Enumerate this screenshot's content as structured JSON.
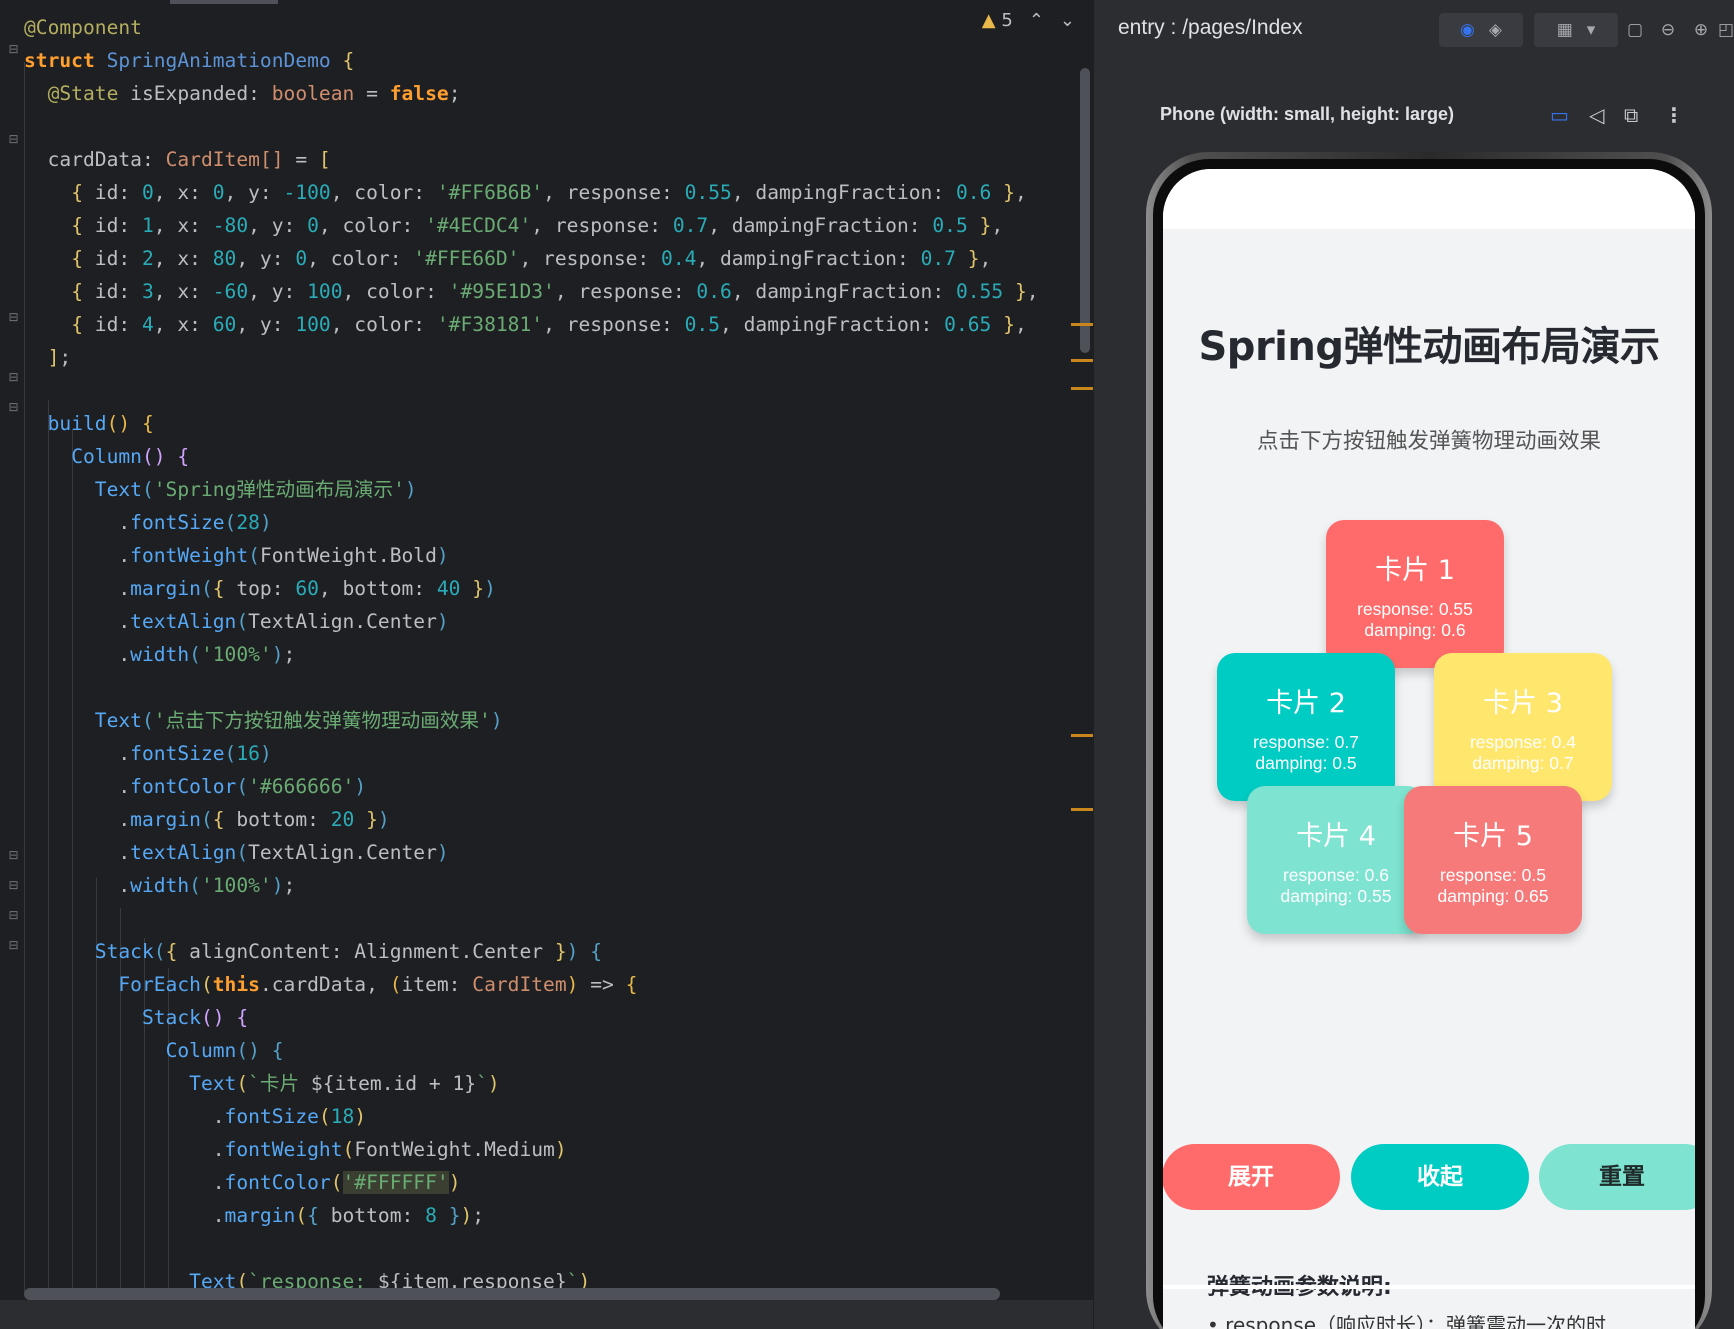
{
  "editor": {
    "warnings_count": "5",
    "lines": [
      {
        "indent": 0,
        "parts": [
          [
            "an",
            "@Component"
          ]
        ]
      },
      {
        "indent": 0,
        "parts": [
          [
            "kb",
            "struct"
          ],
          [
            "cg",
            " "
          ],
          [
            "ty",
            "SpringAnimationDemo"
          ],
          [
            "cg",
            " "
          ],
          [
            "co",
            "{"
          ]
        ]
      },
      {
        "indent": 1,
        "parts": [
          [
            "an",
            "@State"
          ],
          [
            "cg",
            " isExpanded: "
          ],
          [
            "k",
            "boolean"
          ],
          [
            "cg",
            " = "
          ],
          [
            "kb",
            "false"
          ],
          [
            "cg",
            ";"
          ]
        ]
      },
      {
        "indent": 0,
        "parts": []
      },
      {
        "indent": 1,
        "parts": [
          [
            "cg",
            "cardData: "
          ],
          [
            "k",
            "CardItem"
          ],
          [
            "k",
            "[]"
          ],
          [
            "cg",
            " = "
          ],
          [
            "co",
            "["
          ]
        ]
      },
      {
        "indent": 2,
        "parts": [
          [
            "co",
            "{"
          ],
          [
            "cg",
            " id: "
          ],
          [
            "nm",
            "0"
          ],
          [
            "cg",
            ", x: "
          ],
          [
            "nm",
            "0"
          ],
          [
            "cg",
            ", y: "
          ],
          [
            "nm",
            "-100"
          ],
          [
            "cg",
            ", color: "
          ],
          [
            "st",
            "'#FF6B6B'"
          ],
          [
            "cg",
            ", response: "
          ],
          [
            "nm",
            "0.55"
          ],
          [
            "cg",
            ", dampingFraction: "
          ],
          [
            "nm",
            "0.6"
          ],
          [
            "cg",
            " "
          ],
          [
            "co",
            "}"
          ],
          [
            "cg",
            ","
          ]
        ]
      },
      {
        "indent": 2,
        "parts": [
          [
            "co",
            "{"
          ],
          [
            "cg",
            " id: "
          ],
          [
            "nm",
            "1"
          ],
          [
            "cg",
            ", x: "
          ],
          [
            "nm",
            "-80"
          ],
          [
            "cg",
            ", y: "
          ],
          [
            "nm",
            "0"
          ],
          [
            "cg",
            ", color: "
          ],
          [
            "st",
            "'#4ECDC4'"
          ],
          [
            "cg",
            ", response: "
          ],
          [
            "nm",
            "0.7"
          ],
          [
            "cg",
            ", dampingFraction: "
          ],
          [
            "nm",
            "0.5"
          ],
          [
            "cg",
            " "
          ],
          [
            "co",
            "}"
          ],
          [
            "cg",
            ","
          ]
        ]
      },
      {
        "indent": 2,
        "parts": [
          [
            "co",
            "{"
          ],
          [
            "cg",
            " id: "
          ],
          [
            "nm",
            "2"
          ],
          [
            "cg",
            ", x: "
          ],
          [
            "nm",
            "80"
          ],
          [
            "cg",
            ", y: "
          ],
          [
            "nm",
            "0"
          ],
          [
            "cg",
            ", color: "
          ],
          [
            "st",
            "'#FFE66D'"
          ],
          [
            "cg",
            ", response: "
          ],
          [
            "nm",
            "0.4"
          ],
          [
            "cg",
            ", dampingFraction: "
          ],
          [
            "nm",
            "0.7"
          ],
          [
            "cg",
            " "
          ],
          [
            "co",
            "}"
          ],
          [
            "cg",
            ","
          ]
        ]
      },
      {
        "indent": 2,
        "parts": [
          [
            "co",
            "{"
          ],
          [
            "cg",
            " id: "
          ],
          [
            "nm",
            "3"
          ],
          [
            "cg",
            ", x: "
          ],
          [
            "nm",
            "-60"
          ],
          [
            "cg",
            ", y: "
          ],
          [
            "nm",
            "100"
          ],
          [
            "cg",
            ", color: "
          ],
          [
            "st",
            "'#95E1D3'"
          ],
          [
            "cg",
            ", response: "
          ],
          [
            "nm",
            "0.6"
          ],
          [
            "cg",
            ", dampingFraction: "
          ],
          [
            "nm",
            "0.55"
          ],
          [
            "cg",
            " "
          ],
          [
            "co",
            "}"
          ],
          [
            "cg",
            ","
          ]
        ]
      },
      {
        "indent": 2,
        "parts": [
          [
            "co",
            "{"
          ],
          [
            "cg",
            " id: "
          ],
          [
            "nm",
            "4"
          ],
          [
            "cg",
            ", x: "
          ],
          [
            "nm",
            "60"
          ],
          [
            "cg",
            ", y: "
          ],
          [
            "nm",
            "100"
          ],
          [
            "cg",
            ", color: "
          ],
          [
            "st",
            "'#F38181'"
          ],
          [
            "cg",
            ", response: "
          ],
          [
            "nm",
            "0.5"
          ],
          [
            "cg",
            ", dampingFraction: "
          ],
          [
            "nm",
            "0.65"
          ],
          [
            "cg",
            " "
          ],
          [
            "co",
            "}"
          ],
          [
            "cg",
            ","
          ]
        ]
      },
      {
        "indent": 1,
        "parts": [
          [
            "co",
            "]"
          ],
          [
            "cg",
            ";"
          ]
        ]
      },
      {
        "indent": 0,
        "parts": []
      },
      {
        "indent": 1,
        "parts": [
          [
            "fn",
            "build"
          ],
          [
            "yl",
            "()"
          ],
          [
            "cg",
            " "
          ],
          [
            "yl",
            "{"
          ]
        ]
      },
      {
        "indent": 2,
        "parts": [
          [
            "fn",
            "Column"
          ],
          [
            "purp",
            "()"
          ],
          [
            "cg",
            " "
          ],
          [
            "purp",
            "{"
          ]
        ]
      },
      {
        "indent": 3,
        "parts": [
          [
            "fn",
            "Text"
          ],
          [
            "cy",
            "("
          ],
          [
            "st",
            "'Spring弹性动画布局演示'"
          ],
          [
            "cy",
            ")"
          ]
        ]
      },
      {
        "indent": 4,
        "parts": [
          [
            "cg",
            "."
          ],
          [
            "fn",
            "fontSize"
          ],
          [
            "cy",
            "("
          ],
          [
            "nm",
            "28"
          ],
          [
            "cy",
            ")"
          ]
        ]
      },
      {
        "indent": 4,
        "parts": [
          [
            "cg",
            "."
          ],
          [
            "fn",
            "fontWeight"
          ],
          [
            "cy",
            "("
          ],
          [
            "cg",
            "FontWeight.Bold"
          ],
          [
            "cy",
            ")"
          ]
        ]
      },
      {
        "indent": 4,
        "parts": [
          [
            "cg",
            "."
          ],
          [
            "fn",
            "margin"
          ],
          [
            "cy",
            "("
          ],
          [
            "co",
            "{"
          ],
          [
            "cg",
            " top: "
          ],
          [
            "nm",
            "60"
          ],
          [
            "cg",
            ", bottom: "
          ],
          [
            "nm",
            "40"
          ],
          [
            "cg",
            " "
          ],
          [
            "co",
            "}"
          ],
          [
            "cy",
            ")"
          ]
        ]
      },
      {
        "indent": 4,
        "parts": [
          [
            "cg",
            "."
          ],
          [
            "fn",
            "textAlign"
          ],
          [
            "cy",
            "("
          ],
          [
            "cg",
            "TextAlign.Center"
          ],
          [
            "cy",
            ")"
          ]
        ]
      },
      {
        "indent": 4,
        "parts": [
          [
            "cg",
            "."
          ],
          [
            "fn",
            "width"
          ],
          [
            "cy",
            "("
          ],
          [
            "st",
            "'100%'"
          ],
          [
            "cy",
            ")"
          ],
          [
            "cg",
            ";"
          ]
        ]
      },
      {
        "indent": 0,
        "parts": []
      },
      {
        "indent": 3,
        "parts": [
          [
            "fn",
            "Text"
          ],
          [
            "cy",
            "("
          ],
          [
            "st",
            "'点击下方按钮触发弹簧物理动画效果'"
          ],
          [
            "cy",
            ")"
          ]
        ]
      },
      {
        "indent": 4,
        "parts": [
          [
            "cg",
            "."
          ],
          [
            "fn",
            "fontSize"
          ],
          [
            "cy",
            "("
          ],
          [
            "nm",
            "16"
          ],
          [
            "cy",
            ")"
          ]
        ]
      },
      {
        "indent": 4,
        "parts": [
          [
            "cg",
            "."
          ],
          [
            "fn",
            "fontColor"
          ],
          [
            "cy",
            "("
          ],
          [
            "st",
            "'#666666'"
          ],
          [
            "cy",
            ")"
          ]
        ]
      },
      {
        "indent": 4,
        "parts": [
          [
            "cg",
            "."
          ],
          [
            "fn",
            "margin"
          ],
          [
            "cy",
            "("
          ],
          [
            "co",
            "{"
          ],
          [
            "cg",
            " bottom: "
          ],
          [
            "nm",
            "20"
          ],
          [
            "cg",
            " "
          ],
          [
            "co",
            "}"
          ],
          [
            "cy",
            ")"
          ]
        ]
      },
      {
        "indent": 4,
        "parts": [
          [
            "cg",
            "."
          ],
          [
            "fn",
            "textAlign"
          ],
          [
            "cy",
            "("
          ],
          [
            "cg",
            "TextAlign.Center"
          ],
          [
            "cy",
            ")"
          ]
        ]
      },
      {
        "indent": 4,
        "parts": [
          [
            "cg",
            "."
          ],
          [
            "fn",
            "width"
          ],
          [
            "cy",
            "("
          ],
          [
            "st",
            "'100%'"
          ],
          [
            "cy",
            ")"
          ],
          [
            "cg",
            ";"
          ]
        ]
      },
      {
        "indent": 0,
        "parts": []
      },
      {
        "indent": 3,
        "parts": [
          [
            "fn",
            "Stack"
          ],
          [
            "cy",
            "("
          ],
          [
            "co",
            "{"
          ],
          [
            "cg",
            " alignContent: Alignment.Center "
          ],
          [
            "co",
            "}"
          ],
          [
            "cy",
            ")"
          ],
          [
            "cg",
            " "
          ],
          [
            "cy",
            "{"
          ]
        ]
      },
      {
        "indent": 4,
        "parts": [
          [
            "fn",
            "ForEach"
          ],
          [
            "co",
            "("
          ],
          [
            "kb",
            "this"
          ],
          [
            "cg",
            ".cardData, "
          ],
          [
            "yl",
            "("
          ],
          [
            "cg",
            "item: "
          ],
          [
            "k",
            "CardItem"
          ],
          [
            "yl",
            ")"
          ],
          [
            "cg",
            " => "
          ],
          [
            "yl",
            "{"
          ]
        ]
      },
      {
        "indent": 5,
        "parts": [
          [
            "fn",
            "Stack"
          ],
          [
            "purp",
            "()"
          ],
          [
            "cg",
            " "
          ],
          [
            "purp",
            "{"
          ]
        ]
      },
      {
        "indent": 6,
        "parts": [
          [
            "fn",
            "Column"
          ],
          [
            "cy",
            "()"
          ],
          [
            "cg",
            " "
          ],
          [
            "cy",
            "{"
          ]
        ]
      },
      {
        "indent": 7,
        "parts": [
          [
            "fn",
            "Text"
          ],
          [
            "co",
            "("
          ],
          [
            "st",
            "`卡片 "
          ],
          [
            "cg",
            "${item.id + 1}"
          ],
          [
            "st",
            "`"
          ],
          [
            "co",
            ")"
          ]
        ]
      },
      {
        "indent": 8,
        "parts": [
          [
            "cg",
            "."
          ],
          [
            "fn",
            "fontSize"
          ],
          [
            "co",
            "("
          ],
          [
            "nm",
            "18"
          ],
          [
            "co",
            ")"
          ]
        ]
      },
      {
        "indent": 8,
        "parts": [
          [
            "cg",
            "."
          ],
          [
            "fn",
            "fontWeight"
          ],
          [
            "co",
            "("
          ],
          [
            "cg",
            "FontWeight.Medium"
          ],
          [
            "co",
            ")"
          ]
        ]
      },
      {
        "indent": 8,
        "parts": [
          [
            "cg",
            "."
          ],
          [
            "fn",
            "fontColor"
          ],
          [
            "co",
            "("
          ],
          [
            "st",
            "'#FFFFFF'"
          ],
          [
            "co",
            ")"
          ]
        ]
      },
      {
        "indent": 8,
        "parts": [
          [
            "cg",
            "."
          ],
          [
            "fn",
            "margin"
          ],
          [
            "co",
            "("
          ],
          [
            "cy",
            "{"
          ],
          [
            "cg",
            " bottom: "
          ],
          [
            "nm",
            "8"
          ],
          [
            "cg",
            " "
          ],
          [
            "cy",
            "}"
          ],
          [
            "co",
            ")"
          ],
          [
            "cg",
            ";"
          ]
        ]
      },
      {
        "indent": 0,
        "parts": []
      },
      {
        "indent": 7,
        "parts": [
          [
            "fn",
            "Text"
          ],
          [
            "co",
            "("
          ],
          [
            "st",
            "`response: "
          ],
          [
            "cg",
            "${item.response}"
          ],
          [
            "st",
            "`"
          ],
          [
            "co",
            ")"
          ]
        ]
      }
    ]
  },
  "previewer": {
    "title": "entry : /pages/Index",
    "device": "Phone (width: small, height: large)",
    "app": {
      "title": "Spring弹性动画布局演示",
      "subtitle": "点击下方按钮触发弹簧物理动画效果",
      "cards": [
        {
          "label": "卡片 1",
          "response": "response: 0.55",
          "damping": "damping: 0.6",
          "color": "#FF6B6B"
        },
        {
          "label": "卡片 2",
          "response": "response: 0.7",
          "damping": "damping: 0.5",
          "color": "#00CCC4"
        },
        {
          "label": "卡片 3",
          "response": "response: 0.4",
          "damping": "damping: 0.7",
          "color": "#FFE66D"
        },
        {
          "label": "卡片 4",
          "response": "response: 0.6",
          "damping": "damping: 0.55",
          "color": "#7EE3D0"
        },
        {
          "label": "卡片 5",
          "response": "response: 0.5",
          "damping": "damping: 0.65",
          "color": "#F67A7A"
        }
      ],
      "buttons": {
        "expand": "展开",
        "collapse": "收起",
        "reset": "重置"
      },
      "param_title": "弹簧动画参数说明:",
      "param_line": "• response（响应时长）：弹簧震动一次的时"
    }
  }
}
